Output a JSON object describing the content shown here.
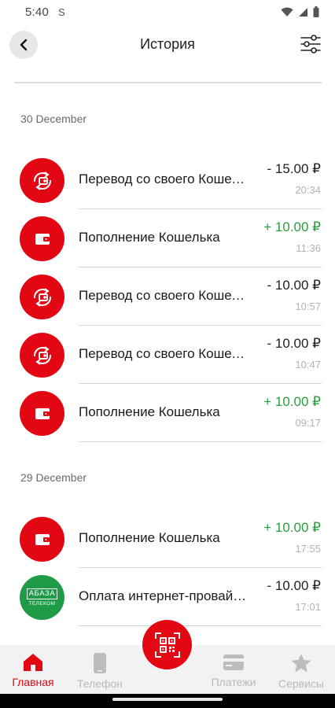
{
  "status_bar": {
    "time": "5:40",
    "carrier_icon": "S"
  },
  "header": {
    "title": "История",
    "back_icon": "chevron-left-icon",
    "filter_icon": "sliders-icon"
  },
  "groups": [
    {
      "date": "30 December",
      "transactions": [
        {
          "icon": "transfer-icon",
          "title": "Перевод со своего Кошелька",
          "amount": "- 15.00 ₽",
          "sign": "minus",
          "time": "20:34"
        },
        {
          "icon": "wallet-icon",
          "title": "Пополнение Кошелька",
          "amount": "+ 10.00 ₽",
          "sign": "plus",
          "time": "11:36"
        },
        {
          "icon": "transfer-icon",
          "title": "Перевод со своего Кошелька",
          "amount": "- 10.00 ₽",
          "sign": "minus",
          "time": "10:57"
        },
        {
          "icon": "transfer-icon",
          "title": "Перевод со своего Кошелька",
          "amount": "- 10.00 ₽",
          "sign": "minus",
          "time": "10:47"
        },
        {
          "icon": "wallet-icon",
          "title": "Пополнение Кошелька",
          "amount": "+ 10.00 ₽",
          "sign": "plus",
          "time": "09:17"
        }
      ]
    },
    {
      "date": "29 December",
      "transactions": [
        {
          "icon": "wallet-icon",
          "title": "Пополнение Кошелька",
          "amount": "+ 10.00 ₽",
          "sign": "plus",
          "time": "17:55"
        },
        {
          "icon": "abaza-logo",
          "logo_top": "АБАЗА",
          "logo_bottom": "ТЕЛЕКОМ",
          "title": "Оплата интернет-провайдера",
          "amount": "- 10.00 ₽",
          "sign": "minus",
          "time": "17:01"
        }
      ]
    }
  ],
  "bottom_nav": {
    "items": [
      {
        "label": "Главная",
        "icon": "home-icon",
        "active": true
      },
      {
        "label": "Телефон",
        "icon": "phone-icon",
        "active": false
      },
      {
        "label": "Платежи",
        "icon": "card-icon",
        "active": false
      },
      {
        "label": "Сервисы",
        "icon": "star-icon",
        "active": false
      }
    ],
    "fab_icon": "qr-code-icon"
  },
  "colors": {
    "accent": "#e30613",
    "plus": "#2a9d3c",
    "logo_green": "#1f9a47"
  }
}
